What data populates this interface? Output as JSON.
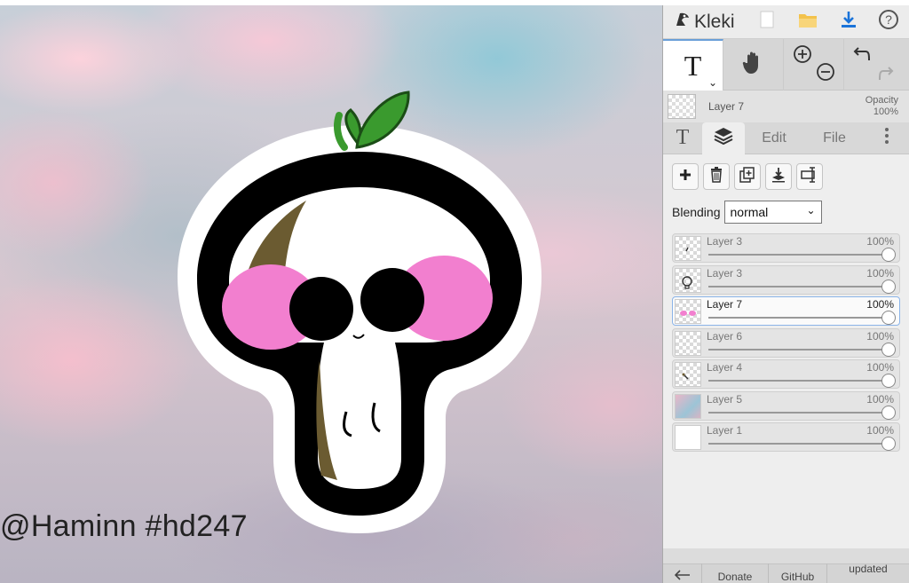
{
  "canvas": {
    "watermark": "@Haminn  #hd247"
  },
  "app": {
    "name": "Kleki"
  },
  "tools": {
    "text_glyph": "T"
  },
  "current_layer": {
    "name": "Layer 7",
    "opacity_label": "Opacity",
    "opacity_value": "100%"
  },
  "tabs": [
    {
      "label": "T",
      "icon": "text-icon"
    },
    {
      "label": "",
      "icon": "layers-icon",
      "active": true
    },
    {
      "label": "Edit"
    },
    {
      "label": "File"
    }
  ],
  "blending": {
    "label": "Blending",
    "value": "normal"
  },
  "layers": [
    {
      "name": "Layer 3",
      "opacity": "100%",
      "thumb": "checker"
    },
    {
      "name": "Layer 3",
      "opacity": "100%",
      "thumb": "checker"
    },
    {
      "name": "Layer 7",
      "opacity": "100%",
      "thumb": "checker",
      "selected": true
    },
    {
      "name": "Layer 6",
      "opacity": "100%",
      "thumb": "checker"
    },
    {
      "name": "Layer 4",
      "opacity": "100%",
      "thumb": "checker"
    },
    {
      "name": "Layer 5",
      "opacity": "100%",
      "thumb": "sky"
    },
    {
      "name": "Layer 1",
      "opacity": "100%",
      "thumb": "white"
    }
  ],
  "footer": {
    "donate": "Donate",
    "github": "GitHub",
    "updated": "updated"
  },
  "colors": {
    "accent": "#6a9fd8",
    "download_blue": "#1a73d9",
    "sprout_green": "#3a9a2e",
    "blush_pink": "#f27fcf"
  }
}
